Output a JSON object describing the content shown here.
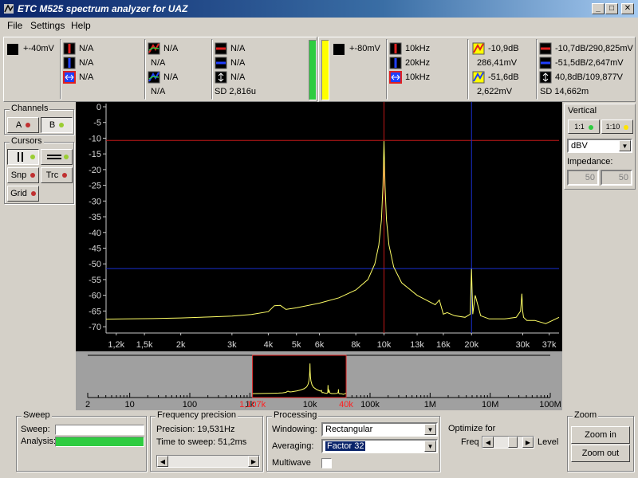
{
  "window": {
    "title": "ETC M525 spectrum analyzer for UAZ",
    "controls": {
      "minimize": "_",
      "maximize": "□",
      "close": "✕"
    }
  },
  "menu": {
    "file": "File",
    "settings": "Settings",
    "help": "Help"
  },
  "status": {
    "chA": {
      "level": "+-40mV",
      "red": "N/A",
      "blue": "N/A",
      "delta": "N/A",
      "peak1": "N/A",
      "peak1b": "N/A",
      "peak2": "N/A",
      "peak2b": "N/A",
      "cur_red": "N/A",
      "cur_blue": "N/A",
      "cur_delta": "N/A",
      "sd": "SD 2,816u",
      "bar_color": "#2ecc40"
    },
    "chB": {
      "level": "+-80mV",
      "red": "10kHz",
      "blue": "20kHz",
      "delta": "10kHz",
      "peak1": "-10,9dB",
      "peak1b": "286,41mV",
      "peak2": "-51,6dB",
      "peak2b": "2,622mV",
      "cur_red": "-10,7dB/290,825mV",
      "cur_blue": "-51,5dB/2,647mV",
      "cur_delta": "40,8dB/109,877V",
      "sd": "SD 14,662m",
      "bar_color": "#ffff00"
    }
  },
  "channels": {
    "title": "Channels",
    "a": "A",
    "b": "B"
  },
  "cursors": {
    "title": "Cursors",
    "snp": "Snp",
    "trc": "Trc",
    "grid": "Grid"
  },
  "vertical": {
    "title": "Vertical",
    "ratio1": "1:1",
    "ratio10": "1:10",
    "unit": "dBV",
    "impedance_label": "Impedance:",
    "imp_a": "50",
    "imp_b": "50"
  },
  "chart_data": {
    "type": "line",
    "y_ticks": [
      "0",
      "-5",
      "-10",
      "-15",
      "-20",
      "-25",
      "-30",
      "-35",
      "-40",
      "-45",
      "-50",
      "-55",
      "-60",
      "-65",
      "-70"
    ],
    "ylim": [
      -72,
      0
    ],
    "x_ticks": [
      "1,2k",
      "1,5k",
      "2k",
      "3k",
      "4k",
      "5k",
      "6k",
      "8k",
      "10k",
      "13k",
      "16k",
      "20k",
      "30k",
      "37k"
    ],
    "x_tick_values": [
      1200,
      1500,
      2000,
      3000,
      4000,
      5000,
      6000,
      8000,
      10000,
      13000,
      16000,
      20000,
      30000,
      37000
    ],
    "xlim": [
      1107,
      40000
    ],
    "x_scale": "log",
    "cursor_red": {
      "x": 10000,
      "y": -10.7
    },
    "cursor_blue": {
      "x": 20000,
      "y": -51.5
    },
    "series": [
      {
        "color": "#ffff66",
        "x": [
          1107,
          1300,
          1600,
          2000,
          2500,
          3000,
          3500,
          4000,
          4200,
          4400,
          4600,
          5000,
          6000,
          7000,
          8000,
          8800,
          9300,
          9600,
          9800,
          9920,
          10000,
          10080,
          10200,
          10400,
          10800,
          11500,
          13000,
          15000,
          15500,
          16000,
          16500,
          17500,
          19000,
          19800,
          20000,
          20200,
          20600,
          21500,
          23000,
          26000,
          28500,
          29500,
          29800,
          30000,
          30200,
          31000,
          33000,
          36000,
          38000,
          40000
        ],
        "y": [
          -67.6,
          -67.5,
          -67.4,
          -67.2,
          -66.9,
          -66.6,
          -66.1,
          -65.2,
          -63.3,
          -63.2,
          -64.5,
          -64.0,
          -62.5,
          -60.8,
          -58.3,
          -55,
          -50,
          -44,
          -36,
          -25,
          -10.9,
          -25,
          -36,
          -44,
          -51,
          -56,
          -60,
          -63,
          -61.5,
          -66,
          -65.5,
          -66.5,
          -67,
          -66,
          -51.6,
          -66,
          -60,
          -66.5,
          -67.5,
          -67.5,
          -67,
          -65,
          -59.5,
          -65,
          -67,
          -68,
          -68,
          -69,
          -68,
          -67
        ]
      }
    ]
  },
  "overview": {
    "ticks": [
      "2",
      "10",
      "100",
      "1k",
      "10k",
      "100k",
      "1M",
      "10M",
      "100M"
    ],
    "tick_values": [
      2,
      10,
      100,
      1000,
      10000,
      100000,
      1000000,
      10000000,
      100000000
    ],
    "range": [
      2,
      100000000
    ],
    "sel_start_label": "1,107k",
    "sel_end_label": "40k",
    "sel_start": 1107,
    "sel_end": 40000,
    "sel_label_color": "#ff2020"
  },
  "sweep": {
    "title": "Sweep",
    "sweep_label": "Sweep:",
    "analysis_label": "Analysis:",
    "analysis_progress": 1.0
  },
  "freqprec": {
    "title": "Frequency precision",
    "precision": "Precision: 19,531Hz",
    "time": "Time to sweep: 51,2ms"
  },
  "processing": {
    "title": "Processing",
    "windowing_label": "Windowing:",
    "windowing": "Rectangular",
    "averaging_label": "Averaging:",
    "averaging": "Factor 32",
    "multiwave_label": "Multiwave"
  },
  "optimize": {
    "title": "Optimize for",
    "freq": "Freq",
    "level": "Level"
  },
  "zoom": {
    "title": "Zoom",
    "zoom_in": "Zoom in",
    "zoom_out": "Zoom out"
  }
}
